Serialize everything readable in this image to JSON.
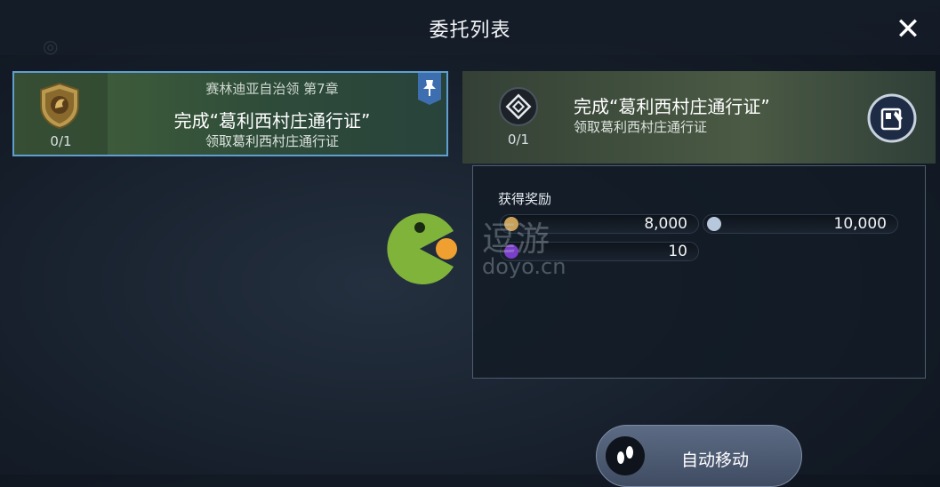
{
  "header": {
    "title": "委托列表"
  },
  "quest_list": [
    {
      "chapter": "赛林迪亚自治领 第7章",
      "name": "完成“葛利西村庄通行证”",
      "sub": "领取葛利西村庄通行证",
      "progress": "0/1",
      "pinned": true
    }
  ],
  "detail": {
    "name": "完成“葛利西村庄通行证”",
    "sub": "领取葛利西村庄通行证",
    "progress": "0/1",
    "rewards_label": "获得奖励",
    "rewards": [
      {
        "icon": "coin-icon",
        "value": "8,000",
        "color": "#c9a25a"
      },
      {
        "icon": "exp-scroll-icon",
        "value": "10,000",
        "color": "#b8c8dc"
      },
      {
        "icon": "purple-orb-icon",
        "value": "10",
        "color": "#7a3ec8"
      }
    ]
  },
  "actions": {
    "auto_move": "自动移动"
  },
  "watermark": {
    "text": "逗游",
    "url": "doyo.cn"
  },
  "colors": {
    "selected_border": "#5f9fd0",
    "quest_bg": "#3c5a3a"
  }
}
